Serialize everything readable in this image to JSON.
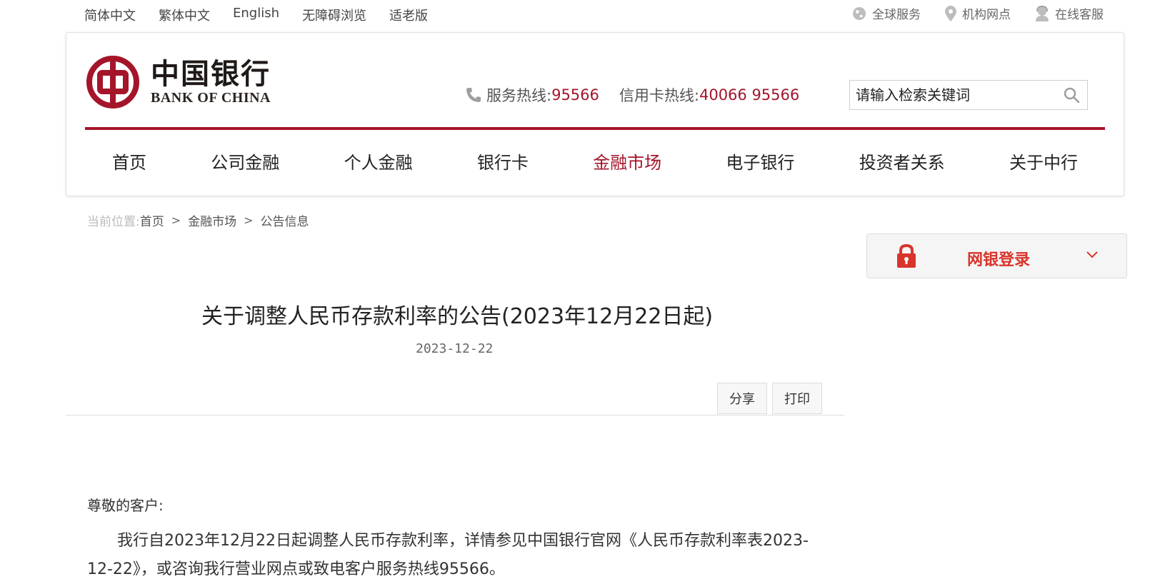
{
  "topbar": {
    "languages": [
      "简体中文",
      "繁体中文",
      "English",
      "无障碍浏览",
      "适老版"
    ],
    "utilities": {
      "global": "全球服务",
      "branches": "机构网点",
      "online_service": "在线客服"
    }
  },
  "header": {
    "logo_cn": "中国银行",
    "logo_en": "BANK OF CHINA",
    "service_hotline_label": "服务热线:",
    "service_hotline_number": "95566",
    "credit_hotline_label": "信用卡热线:",
    "credit_hotline_number": "40066 95566",
    "search_placeholder": "请输入检索关键词"
  },
  "nav": {
    "items": [
      "首页",
      "公司金融",
      "个人金融",
      "银行卡",
      "金融市场",
      "电子银行",
      "投资者关系",
      "关于中行"
    ],
    "active": "金融市场"
  },
  "breadcrumb": {
    "prefix": "当前位置:",
    "items": [
      "首页",
      "金融市场",
      "公告信息"
    ]
  },
  "netbank": {
    "label": "网银登录"
  },
  "article": {
    "title": "关于调整人民币存款利率的公告(2023年12月22日起)",
    "date": "2023-12-22",
    "share_label": "分享",
    "print_label": "打印",
    "greeting": "尊敬的客户:",
    "body": "我行自2023年12月22日起调整人民币存款利率，详情参见中国银行官网《人民币存款利率表2023-12-22》，或咨询我行营业网点或致电客户服务热线95566。"
  },
  "colors": {
    "brand_red": "#a4152a",
    "login_red": "#d9342b"
  }
}
